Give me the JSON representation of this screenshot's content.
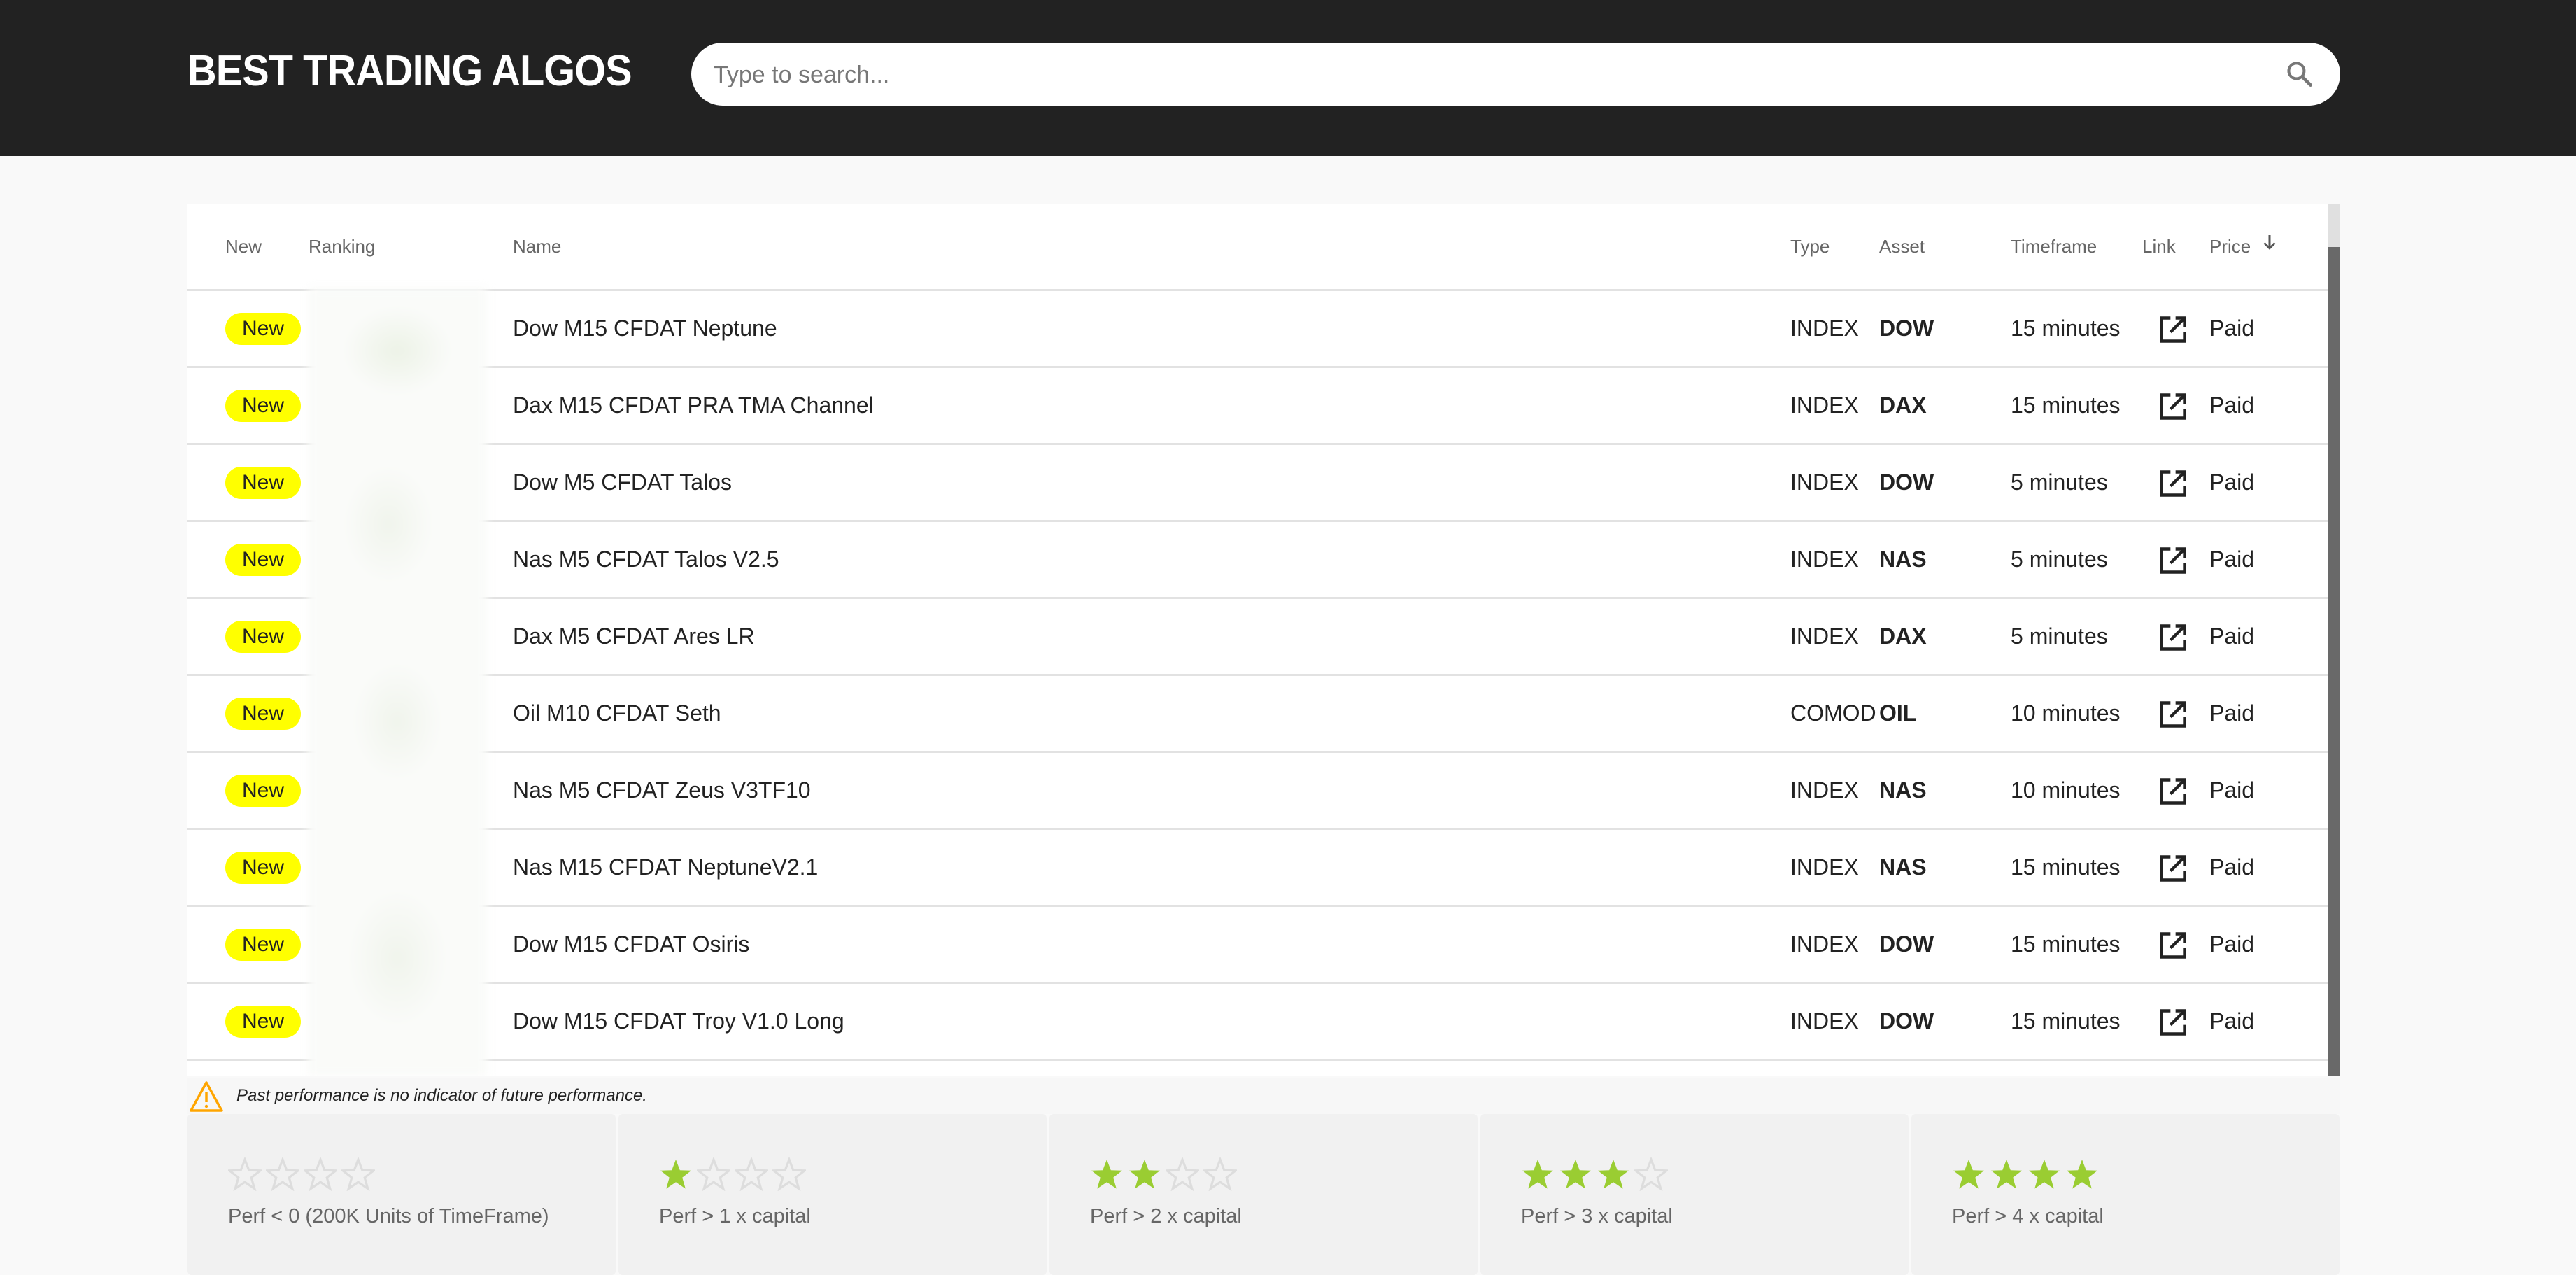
{
  "header": {
    "title": "BEST TRADING ALGOS",
    "search": {
      "placeholder": "Type to search...",
      "value": "",
      "icon": "search-icon"
    }
  },
  "table": {
    "columns": [
      {
        "key": "new",
        "label": "New"
      },
      {
        "key": "ranking",
        "label": "Ranking"
      },
      {
        "key": "name",
        "label": "Name"
      },
      {
        "key": "type",
        "label": "Type"
      },
      {
        "key": "asset",
        "label": "Asset"
      },
      {
        "key": "timeframe",
        "label": "Timeframe"
      },
      {
        "key": "link",
        "label": "Link"
      },
      {
        "key": "price",
        "label": "Price",
        "sort": "descending",
        "sort_icon": "arrow-down-icon"
      }
    ],
    "ranking_obscured": true,
    "rows": [
      {
        "new": "New",
        "name": "Dow M15 CFDAT Neptune",
        "type": "INDEX",
        "asset": "DOW",
        "timeframe": "15 minutes",
        "link_icon": "open-in-new-icon",
        "price": "Paid"
      },
      {
        "new": "New",
        "name": "Dax M15 CFDAT PRA TMA Channel",
        "type": "INDEX",
        "asset": "DAX",
        "timeframe": "15 minutes",
        "link_icon": "open-in-new-icon",
        "price": "Paid"
      },
      {
        "new": "New",
        "name": "Dow M5 CFDAT Talos",
        "type": "INDEX",
        "asset": "DOW",
        "timeframe": "5 minutes",
        "link_icon": "open-in-new-icon",
        "price": "Paid"
      },
      {
        "new": "New",
        "name": "Nas M5 CFDAT Talos V2.5",
        "type": "INDEX",
        "asset": "NAS",
        "timeframe": "5 minutes",
        "link_icon": "open-in-new-icon",
        "price": "Paid"
      },
      {
        "new": "New",
        "name": "Dax M5 CFDAT Ares LR",
        "type": "INDEX",
        "asset": "DAX",
        "timeframe": "5 minutes",
        "link_icon": "open-in-new-icon",
        "price": "Paid"
      },
      {
        "new": "New",
        "name": "Oil M10 CFDAT Seth",
        "type": "COMOD",
        "asset": "OIL",
        "timeframe": "10 minutes",
        "link_icon": "open-in-new-icon",
        "price": "Paid"
      },
      {
        "new": "New",
        "name": "Nas M5 CFDAT Zeus V3TF10",
        "type": "INDEX",
        "asset": "NAS",
        "timeframe": "10 minutes",
        "link_icon": "open-in-new-icon",
        "price": "Paid"
      },
      {
        "new": "New",
        "name": "Nas M15 CFDAT NeptuneV2.1",
        "type": "INDEX",
        "asset": "NAS",
        "timeframe": "15 minutes",
        "link_icon": "open-in-new-icon",
        "price": "Paid"
      },
      {
        "new": "New",
        "name": "Dow M15 CFDAT Osiris",
        "type": "INDEX",
        "asset": "DOW",
        "timeframe": "15 minutes",
        "link_icon": "open-in-new-icon",
        "price": "Paid"
      },
      {
        "new": "New",
        "name": "Dow M15 CFDAT Troy V1.0 Long",
        "type": "INDEX",
        "asset": "DOW",
        "timeframe": "15 minutes",
        "link_icon": "open-in-new-icon",
        "price": "Paid"
      }
    ]
  },
  "disclaimer": {
    "icon": "warning-icon",
    "text": "Past performance is no indicator of future performance."
  },
  "legend": {
    "max_stars": 4,
    "items": [
      {
        "stars": 0,
        "label": "Perf < 0 (200K Units of TimeFrame)"
      },
      {
        "stars": 1,
        "label": "Perf > 1 x capital"
      },
      {
        "stars": 2,
        "label": "Perf > 2 x capital"
      },
      {
        "stars": 3,
        "label": "Perf > 3 x capital"
      },
      {
        "stars": 4,
        "label": "Perf > 4 x capital"
      }
    ]
  },
  "colors": {
    "header_bg": "#222222",
    "new_badge": "#ffff00",
    "star_filled": "#9acd32",
    "star_empty": "#dddddd",
    "warning": "#ffa500",
    "scroll_thumb": "#696969"
  }
}
